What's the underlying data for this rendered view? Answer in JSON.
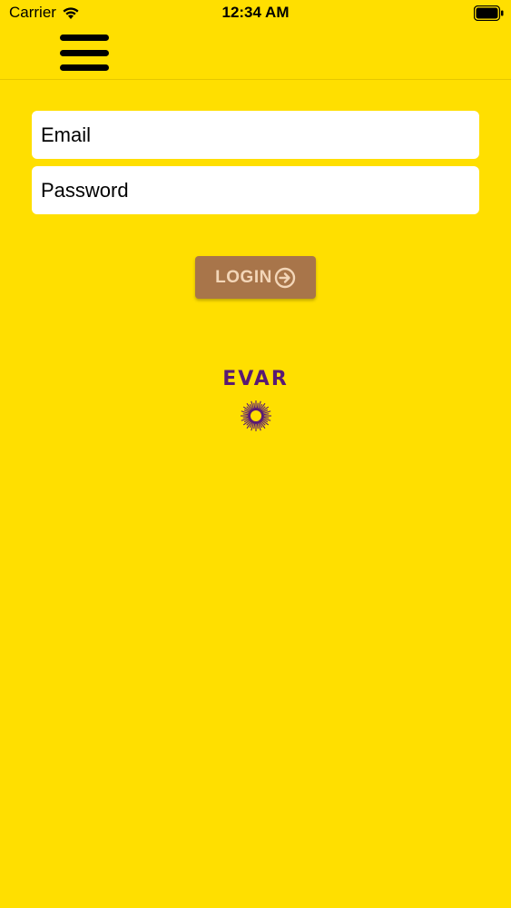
{
  "status_bar": {
    "carrier": "Carrier",
    "time": "12:34 AM"
  },
  "nav": {
    "menu_icon": "hamburger-menu-icon"
  },
  "login_form": {
    "email_placeholder": "Email",
    "password_placeholder": "Password",
    "login_label": "LOGIN",
    "login_icon": "arrow-circle-right-icon"
  },
  "logo": {
    "text": "EVAR",
    "icon": "sunburst-logo-icon"
  },
  "colors": {
    "background": "#FFDF00",
    "button": "#A8754A",
    "button_text": "#F3D6B8",
    "logo": "#5A1A72"
  }
}
